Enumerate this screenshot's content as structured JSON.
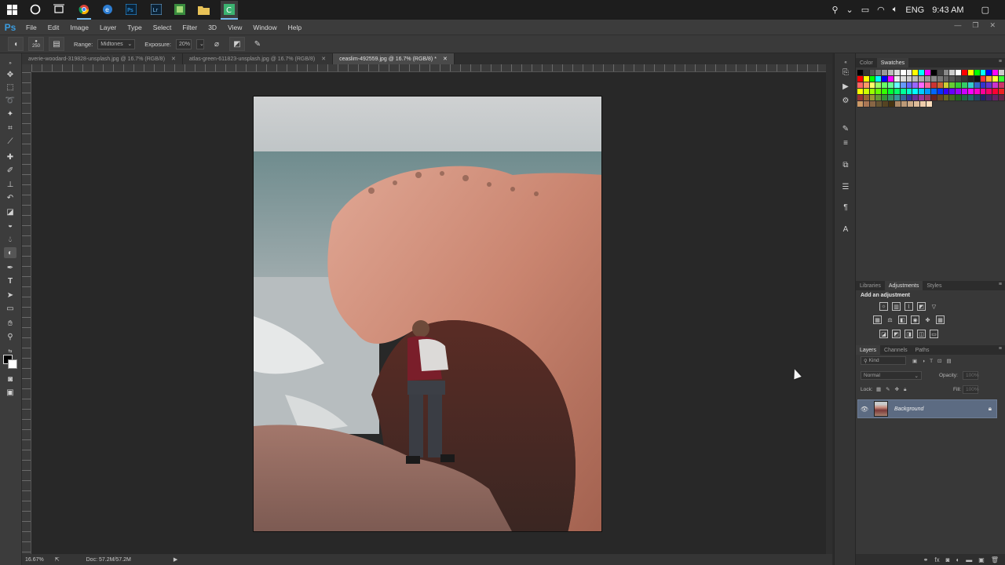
{
  "taskbar": {
    "icons": [
      "windows-start-icon",
      "cortana-circle-icon",
      "task-view-icon",
      "chrome-icon",
      "edge-icon",
      "photoshop-icon",
      "lightroom-icon",
      "green-app-icon",
      "file-explorer-icon",
      "camtasia-icon"
    ],
    "language": "ENG",
    "time": "9:43 AM"
  },
  "menubar": {
    "logo": "Ps",
    "items": [
      "File",
      "Edit",
      "Image",
      "Layer",
      "Type",
      "Select",
      "Filter",
      "3D",
      "View",
      "Window",
      "Help"
    ]
  },
  "options": {
    "brush_size": "250",
    "range_label": "Range:",
    "range_value": "Midtones",
    "exposure_label": "Exposure:",
    "exposure_value": "20%"
  },
  "tabs": [
    {
      "label": "averie-woodard-319828-unsplash.jpg @ 16.7% (RGB/8)",
      "active": false
    },
    {
      "label": "atlas-green-611823-unsplash.jpg @ 16.7% (RGB/8)",
      "active": false
    },
    {
      "label": "ceaslim-492559.jpg @ 16.7% (RGB/8) *",
      "active": true
    }
  ],
  "status": {
    "zoom": "16.67%",
    "doc": "Doc: 57.2M/57.2M"
  },
  "panels": {
    "color_tabs": [
      "Color",
      "Swatches"
    ],
    "adjust_tabs": [
      "Libraries",
      "Adjustments",
      "Styles"
    ],
    "adjust_title": "Add an adjustment",
    "layers_tabs": [
      "Layers",
      "Channels",
      "Paths"
    ],
    "kind_label": "Kind",
    "blend_mode": "Normal",
    "opacity_label": "Opacity:",
    "opacity_value": "100%",
    "lock_label": "Lock:",
    "fill_label": "Fill:",
    "fill_value": "100%",
    "layer_name": "Background"
  },
  "colors": {
    "ps_blue": "#3b9cdf",
    "selected_layer": "#5c6b82"
  }
}
